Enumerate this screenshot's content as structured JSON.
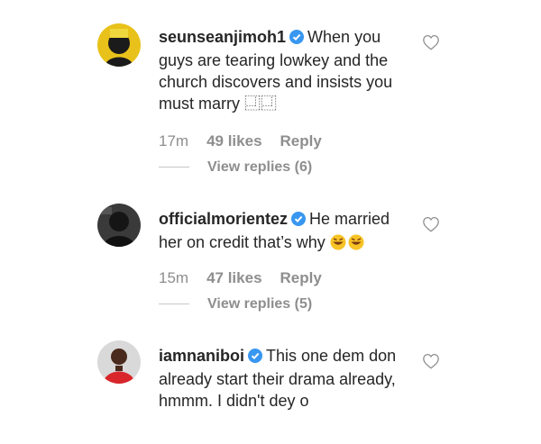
{
  "comments": [
    {
      "username": "seunseanjimoh1",
      "text": "When you guys are tearing lowkey and the church discovers and insists you must marry ⿽⿽",
      "time": "17m",
      "likes": "49 likes",
      "reply": "Reply",
      "view_replies": "View replies (6)",
      "avatar_icon": "avatar-yellow-icon"
    },
    {
      "username": "officialmorientez",
      "text": "He married her on credit that’s why",
      "emoji": "laughing-emoji",
      "time": "15m",
      "likes": "47 likes",
      "reply": "Reply",
      "view_replies": "View replies (5)",
      "avatar_icon": "avatar-dark-icon"
    },
    {
      "username": "iamnaniboi",
      "text": "This one dem don already start their drama already, hmmm. I didn't dey o",
      "avatar_icon": "avatar-red-icon"
    }
  ],
  "colors": {
    "verified": "#3897f0",
    "muted": "#8e8e8e",
    "text": "#262626"
  }
}
